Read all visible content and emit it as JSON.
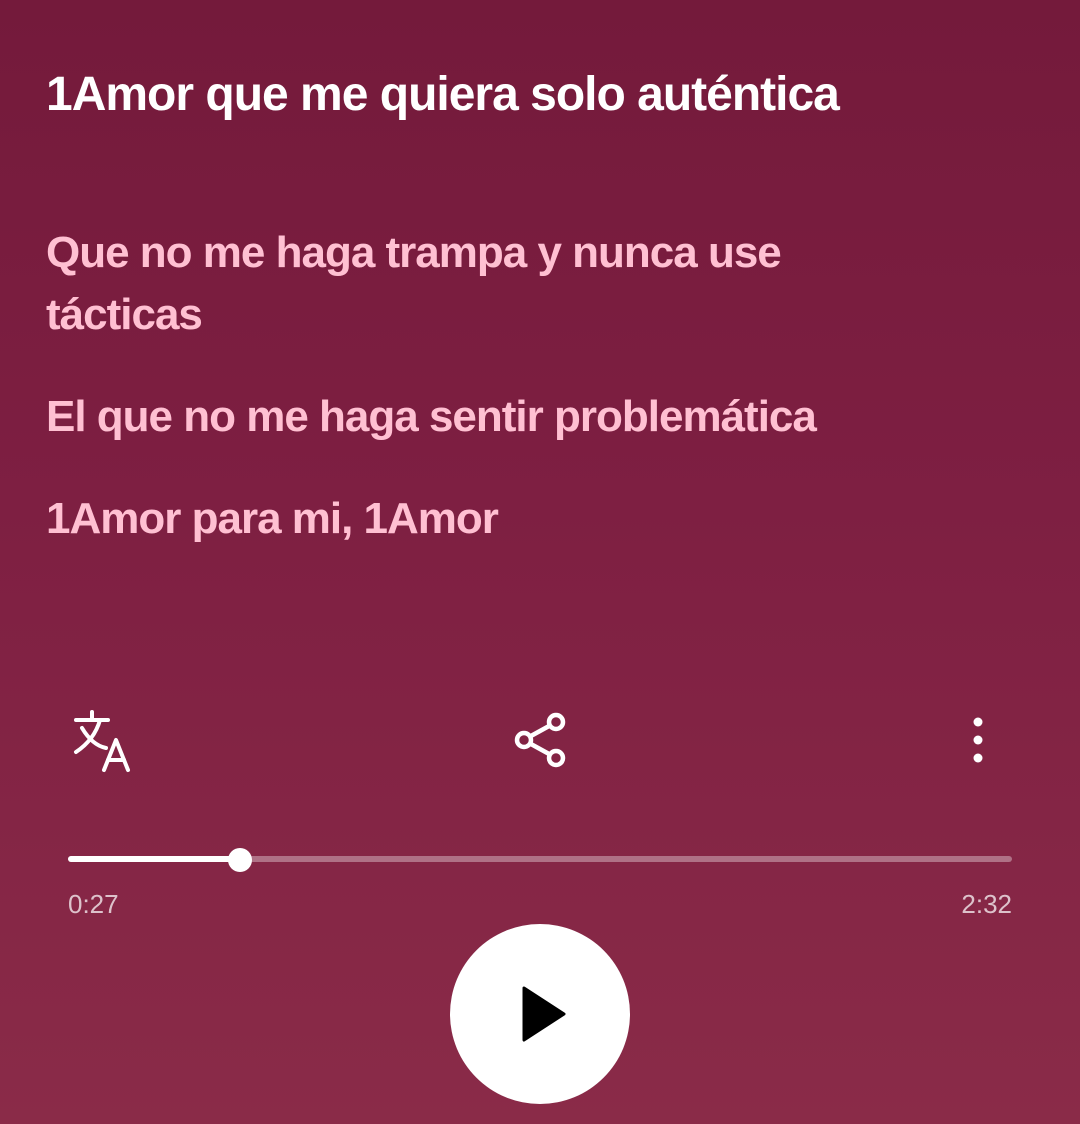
{
  "lyrics": {
    "current_line": "1Amor que me quiera solo auténtica",
    "upcoming": [
      "Que no me haga trampa y nunca use tácticas",
      "El que no me haga sentir problemática",
      "1Amor para mi, 1Amor"
    ]
  },
  "actions": {
    "translate_icon": "translate-icon",
    "share_icon": "share-icon",
    "more_icon": "more-vertical-icon"
  },
  "player": {
    "elapsed": "0:27",
    "total": "2:32",
    "progress": 0.182,
    "play_icon": "play-icon"
  },
  "colors": {
    "background_top": "#741a3b",
    "background_bottom": "#8a2b48",
    "current_line": "#ffffff",
    "upcoming_line": "#ffc0d2",
    "accent": "#ffffff"
  }
}
